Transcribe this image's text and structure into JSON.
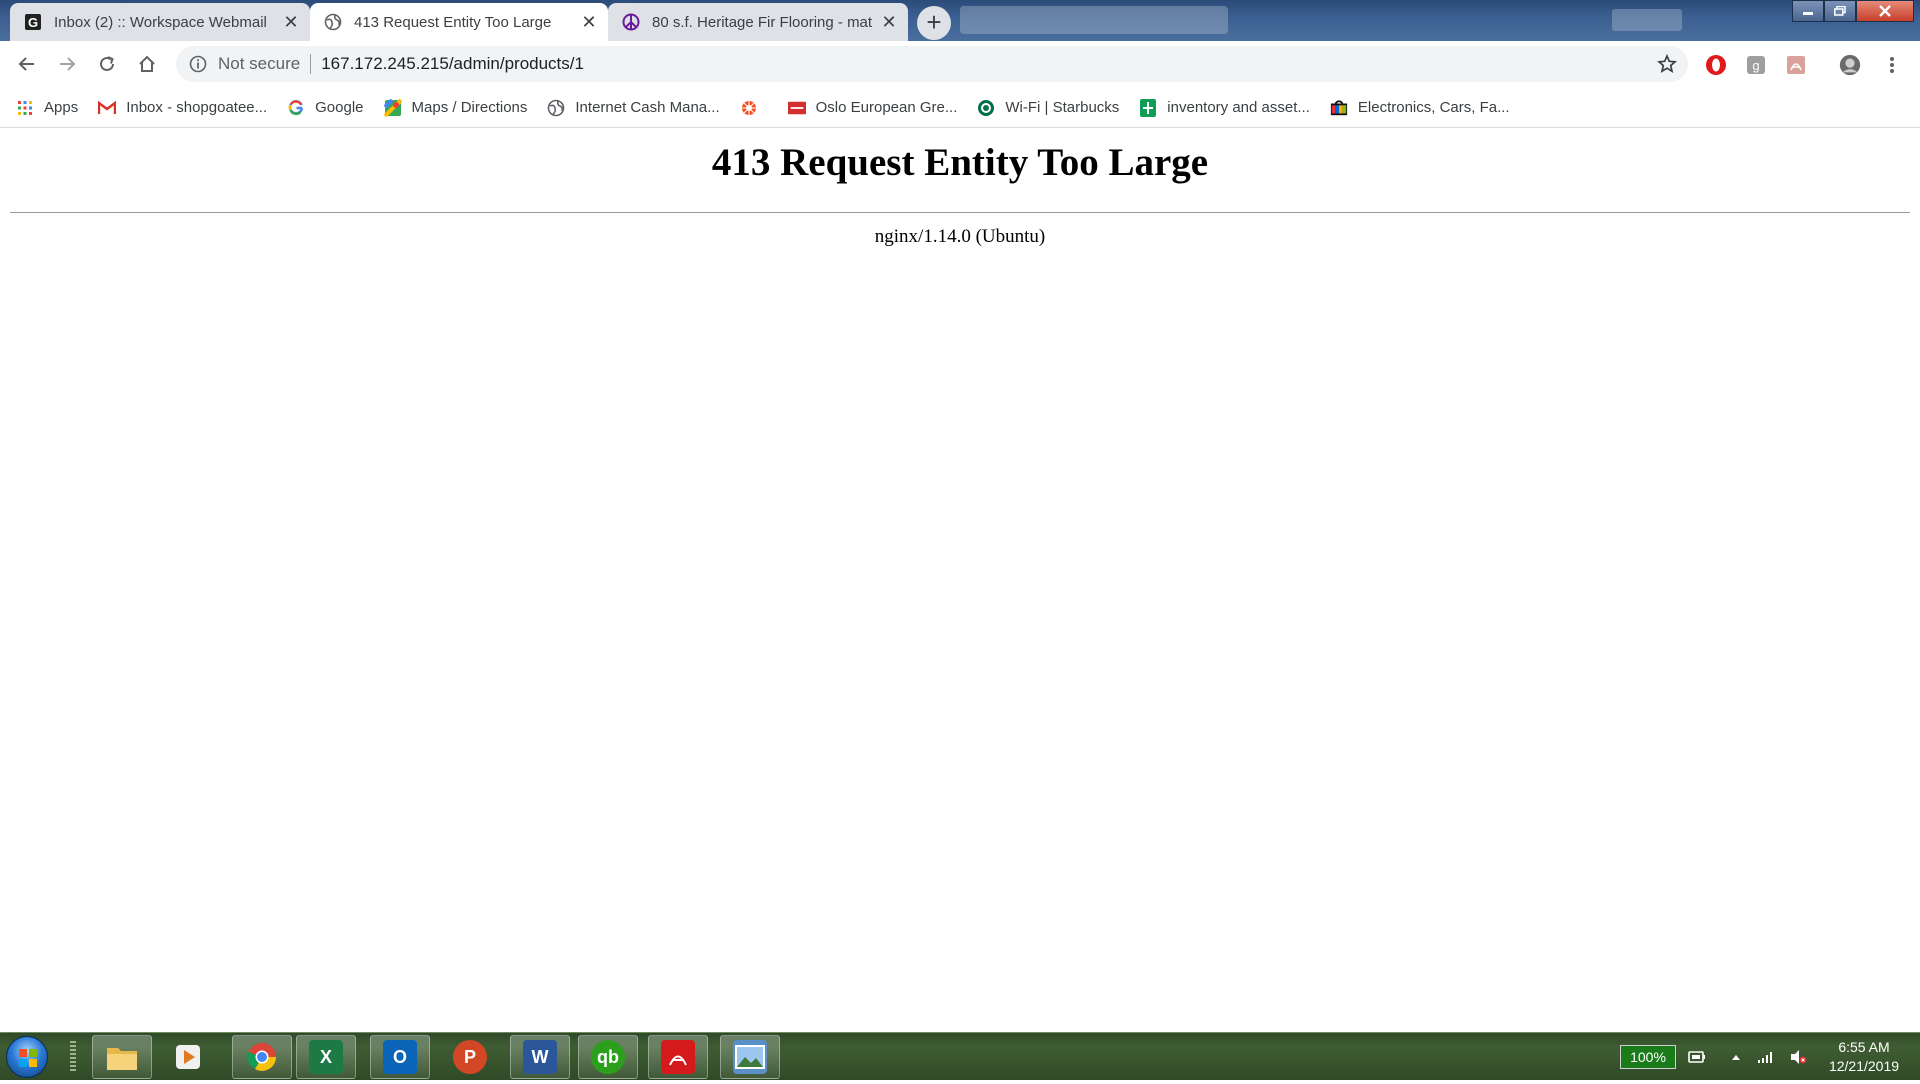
{
  "browser": {
    "tabs": [
      {
        "title": "Inbox (2) :: Workspace Webmail",
        "favicon": "g-square-icon",
        "active": false
      },
      {
        "title": "413 Request Entity Too Large",
        "favicon": "globe-icon",
        "active": true
      },
      {
        "title": "80 s.f. Heritage Fir Flooring - mat",
        "favicon": "peace-sign-icon",
        "active": false
      }
    ],
    "new_tab_label": "+",
    "close_glyph": "✕"
  },
  "toolbar": {
    "security_label": "Not secure",
    "url": "167.172.245.215/admin/products/1"
  },
  "bookmarks": [
    {
      "label": "Apps",
      "icon": "apps-grid-icon"
    },
    {
      "label": "Inbox - shopgoatee...",
      "icon": "gmail-icon"
    },
    {
      "label": "Google",
      "icon": "google-icon"
    },
    {
      "label": "Maps / Directions",
      "icon": "maps-icon"
    },
    {
      "label": "Internet Cash Mana...",
      "icon": "globe-icon"
    },
    {
      "label": "",
      "icon": "flower-icon"
    },
    {
      "label": "Oslo European Gre...",
      "icon": "red-card-icon"
    },
    {
      "label": "Wi-Fi | Starbucks",
      "icon": "starbucks-icon"
    },
    {
      "label": "inventory and asset...",
      "icon": "sheets-icon"
    },
    {
      "label": "Electronics, Cars, Fa...",
      "icon": "ebay-bag-icon"
    }
  ],
  "page": {
    "heading": "413 Request Entity Too Large",
    "server": "nginx/1.14.0 (Ubuntu)"
  },
  "taskbar": {
    "apps": [
      {
        "name": "file-explorer",
        "letter": "",
        "color": "#e6b84a"
      },
      {
        "name": "media-player",
        "letter": "",
        "color": "#e07a1f"
      },
      {
        "name": "chrome",
        "letter": "",
        "color": "#db4437"
      },
      {
        "name": "excel",
        "letter": "X",
        "color": "#1d7a45"
      },
      {
        "name": "outlook",
        "letter": "O",
        "color": "#0a64b8"
      },
      {
        "name": "powerpoint",
        "letter": "P",
        "color": "#d24726"
      },
      {
        "name": "word",
        "letter": "W",
        "color": "#2b579a"
      },
      {
        "name": "quickbooks",
        "letter": "qb",
        "color": "#2ca01c"
      },
      {
        "name": "acrobat",
        "letter": "",
        "color": "#d41a1a"
      },
      {
        "name": "photos",
        "letter": "",
        "color": "#5b8fc7"
      }
    ],
    "battery": "100%",
    "time": "6:55 AM",
    "date": "12/21/2019"
  }
}
